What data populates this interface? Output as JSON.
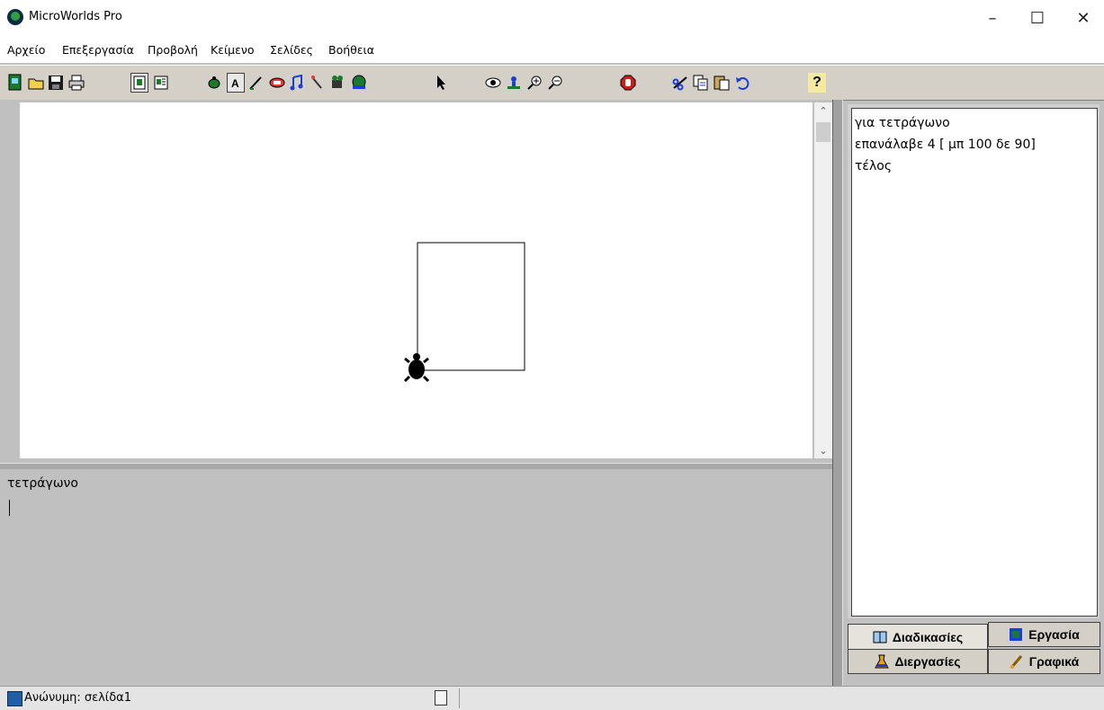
{
  "window": {
    "title": "MicroWorlds Pro",
    "minimize": "–",
    "maximize": "☐",
    "close": "✕"
  },
  "menu": {
    "items": [
      "Αρχείο",
      "Επεξεργασία",
      "Προβολή",
      "Κείμενο",
      "Σελίδες",
      "Βοήθεια"
    ]
  },
  "toolbar": {
    "icons": [
      "new-page",
      "open",
      "save",
      "print",
      "page-view",
      "procedures-view",
      "hatch-turtle",
      "text-box",
      "paint",
      "button",
      "melody",
      "sound",
      "video",
      "slider",
      "pointer",
      "eye",
      "stamp",
      "zoom-in",
      "zoom-out",
      "stop",
      "cut",
      "copy",
      "paste",
      "undo",
      "help"
    ],
    "help_label": "?"
  },
  "canvas": {
    "background": "#ffffff",
    "drawing": {
      "shape": "square",
      "side": 100,
      "turn": 90,
      "repeat": 4
    },
    "turtle_color": "#000000"
  },
  "command_center": {
    "text": "τετράγωνο"
  },
  "procedures": {
    "lines": [
      "για τετράγωνο",
      "επανάλαβε 4 [ μπ 100 δε 90]",
      "τέλος"
    ]
  },
  "tabs": {
    "procedures": "Διαδικασίες",
    "project": "Εργασία",
    "processes": "Διεργασίες",
    "graphics": "Γραφικά"
  },
  "status": {
    "page": "Ανώνυμη:  σελίδα1"
  },
  "colors": {
    "chrome": "#c0c0c0",
    "panel": "#d4d0c8"
  }
}
